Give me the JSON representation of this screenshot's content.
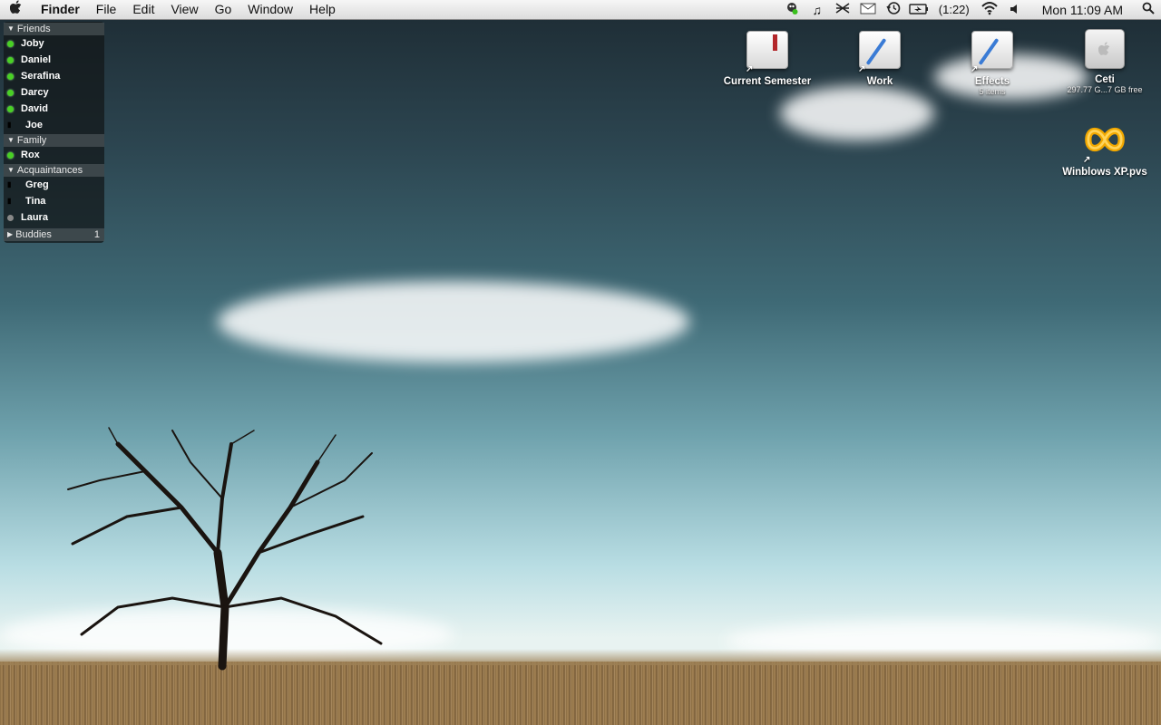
{
  "menubar": {
    "apple": "",
    "app_name": "Finder",
    "items": [
      "File",
      "Edit",
      "View",
      "Go",
      "Window",
      "Help"
    ],
    "battery_time": "(1:22)",
    "clock": "Mon 11:09 AM"
  },
  "buddy_list": {
    "groups": [
      {
        "name": "Friends",
        "expanded": true,
        "buddies": [
          {
            "name": "Joby",
            "status": "online"
          },
          {
            "name": "Daniel",
            "status": "online"
          },
          {
            "name": "Serafina",
            "status": "online"
          },
          {
            "name": "Darcy",
            "status": "online"
          },
          {
            "name": "David",
            "status": "online"
          },
          {
            "name": "Joe",
            "status": "mobile"
          }
        ]
      },
      {
        "name": "Family",
        "expanded": true,
        "buddies": [
          {
            "name": "Rox",
            "status": "online"
          }
        ]
      },
      {
        "name": "Acquaintances",
        "expanded": true,
        "buddies": [
          {
            "name": "Greg",
            "status": "mobile"
          },
          {
            "name": "Tina",
            "status": "mobile"
          },
          {
            "name": "Laura",
            "status": "away"
          }
        ]
      },
      {
        "name": "Buddies",
        "expanded": false,
        "count": "1",
        "buddies": []
      }
    ]
  },
  "desktop_icons": [
    {
      "label": "Current Semester",
      "subtitle": "",
      "icon": "folder-bookmark-icon"
    },
    {
      "label": "Work",
      "subtitle": "",
      "icon": "folder-pen-icon"
    },
    {
      "label": "Effects",
      "subtitle": "5 items",
      "icon": "folder-pen-icon"
    },
    {
      "label": "Ceti",
      "subtitle": "297.77 G...7 GB free",
      "icon": "hard-drive-icon"
    },
    {
      "label": "Winblows XP.pvs",
      "subtitle": "",
      "icon": "parallels-icon"
    }
  ],
  "colors": {
    "online": "#49d024",
    "away": "#888888",
    "pvs_accent": "#f2a800"
  }
}
